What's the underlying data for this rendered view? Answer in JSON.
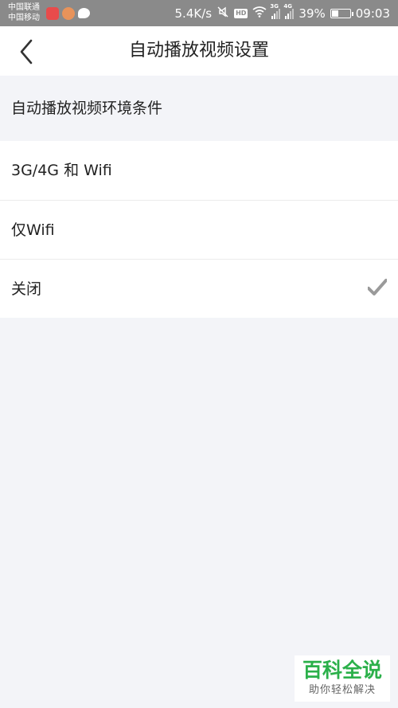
{
  "status_bar": {
    "carrier_1": "中国联通",
    "carrier_2": "中国移动",
    "net_speed": "5.4K/s",
    "hd_label": "HD",
    "signal_1_label": "3G",
    "signal_2_label": "4G",
    "battery_percent_text": "39%",
    "battery_level": 0.39,
    "time": "09:03",
    "icons": [
      "netease-music-icon",
      "chat-bubble-app-icon",
      "wechat-icon",
      "mute-icon",
      "hd-icon",
      "wifi-icon",
      "signal-icon",
      "battery-icon"
    ]
  },
  "header": {
    "back_icon": "chevron-left-icon",
    "title": "自动播放视频设置"
  },
  "section": {
    "label": "自动播放视频环境条件"
  },
  "options": [
    {
      "label": "3G/4G 和 Wifi",
      "selected": false
    },
    {
      "label": "仅Wifi",
      "selected": false
    },
    {
      "label": "关闭",
      "selected": true
    }
  ],
  "colors": {
    "status_bar_bg": "#8a8a8a",
    "page_bg": "#f3f4f8",
    "check": "#9a9a9a",
    "watermark_green": "#2bb04a"
  },
  "watermark": {
    "title": "百科全说",
    "subtitle": "助你轻松解决"
  }
}
